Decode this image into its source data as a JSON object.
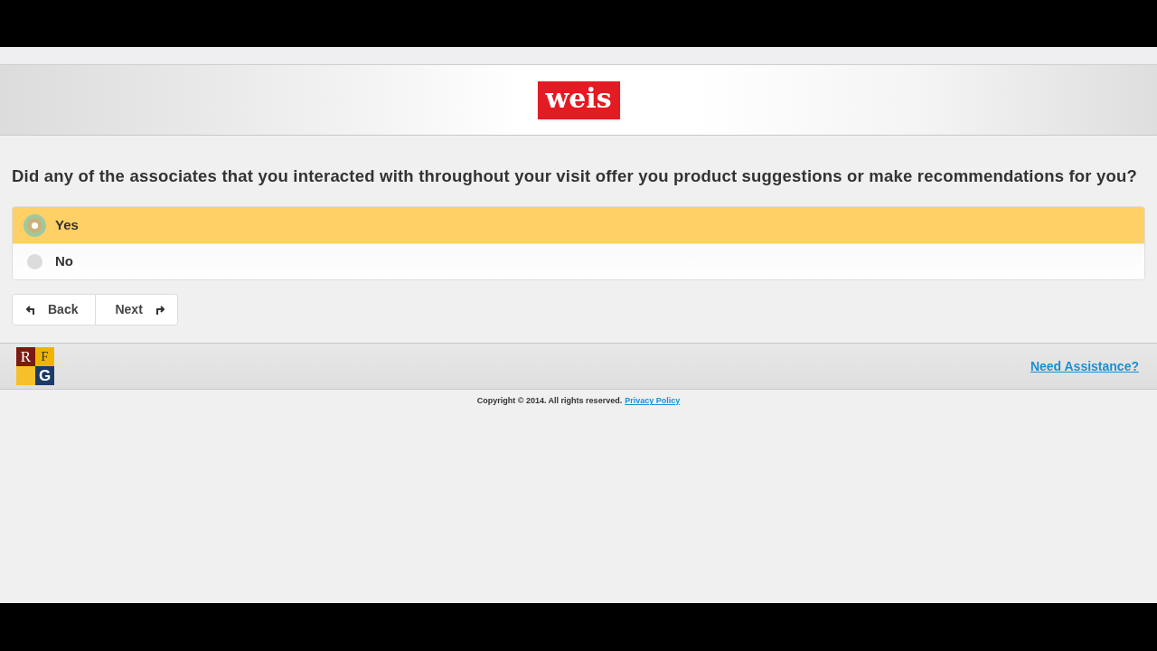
{
  "header": {
    "logo": "weis"
  },
  "question": "Did any of the associates that you interacted with throughout your visit offer you product suggestions or make recommendations for you?",
  "options": [
    {
      "label": "Yes",
      "selected": true
    },
    {
      "label": "No",
      "selected": false
    }
  ],
  "buttons": [
    {
      "label": "Back",
      "kind": "back"
    },
    {
      "label": "Next",
      "kind": "next"
    }
  ],
  "footer": {
    "logo_letters": [
      "R",
      "F",
      "G"
    ],
    "assistance_link": "Need Assistance?",
    "copyright": "Copyright © 2014. All rights reserved.",
    "privacy_link": "Privacy Policy"
  }
}
